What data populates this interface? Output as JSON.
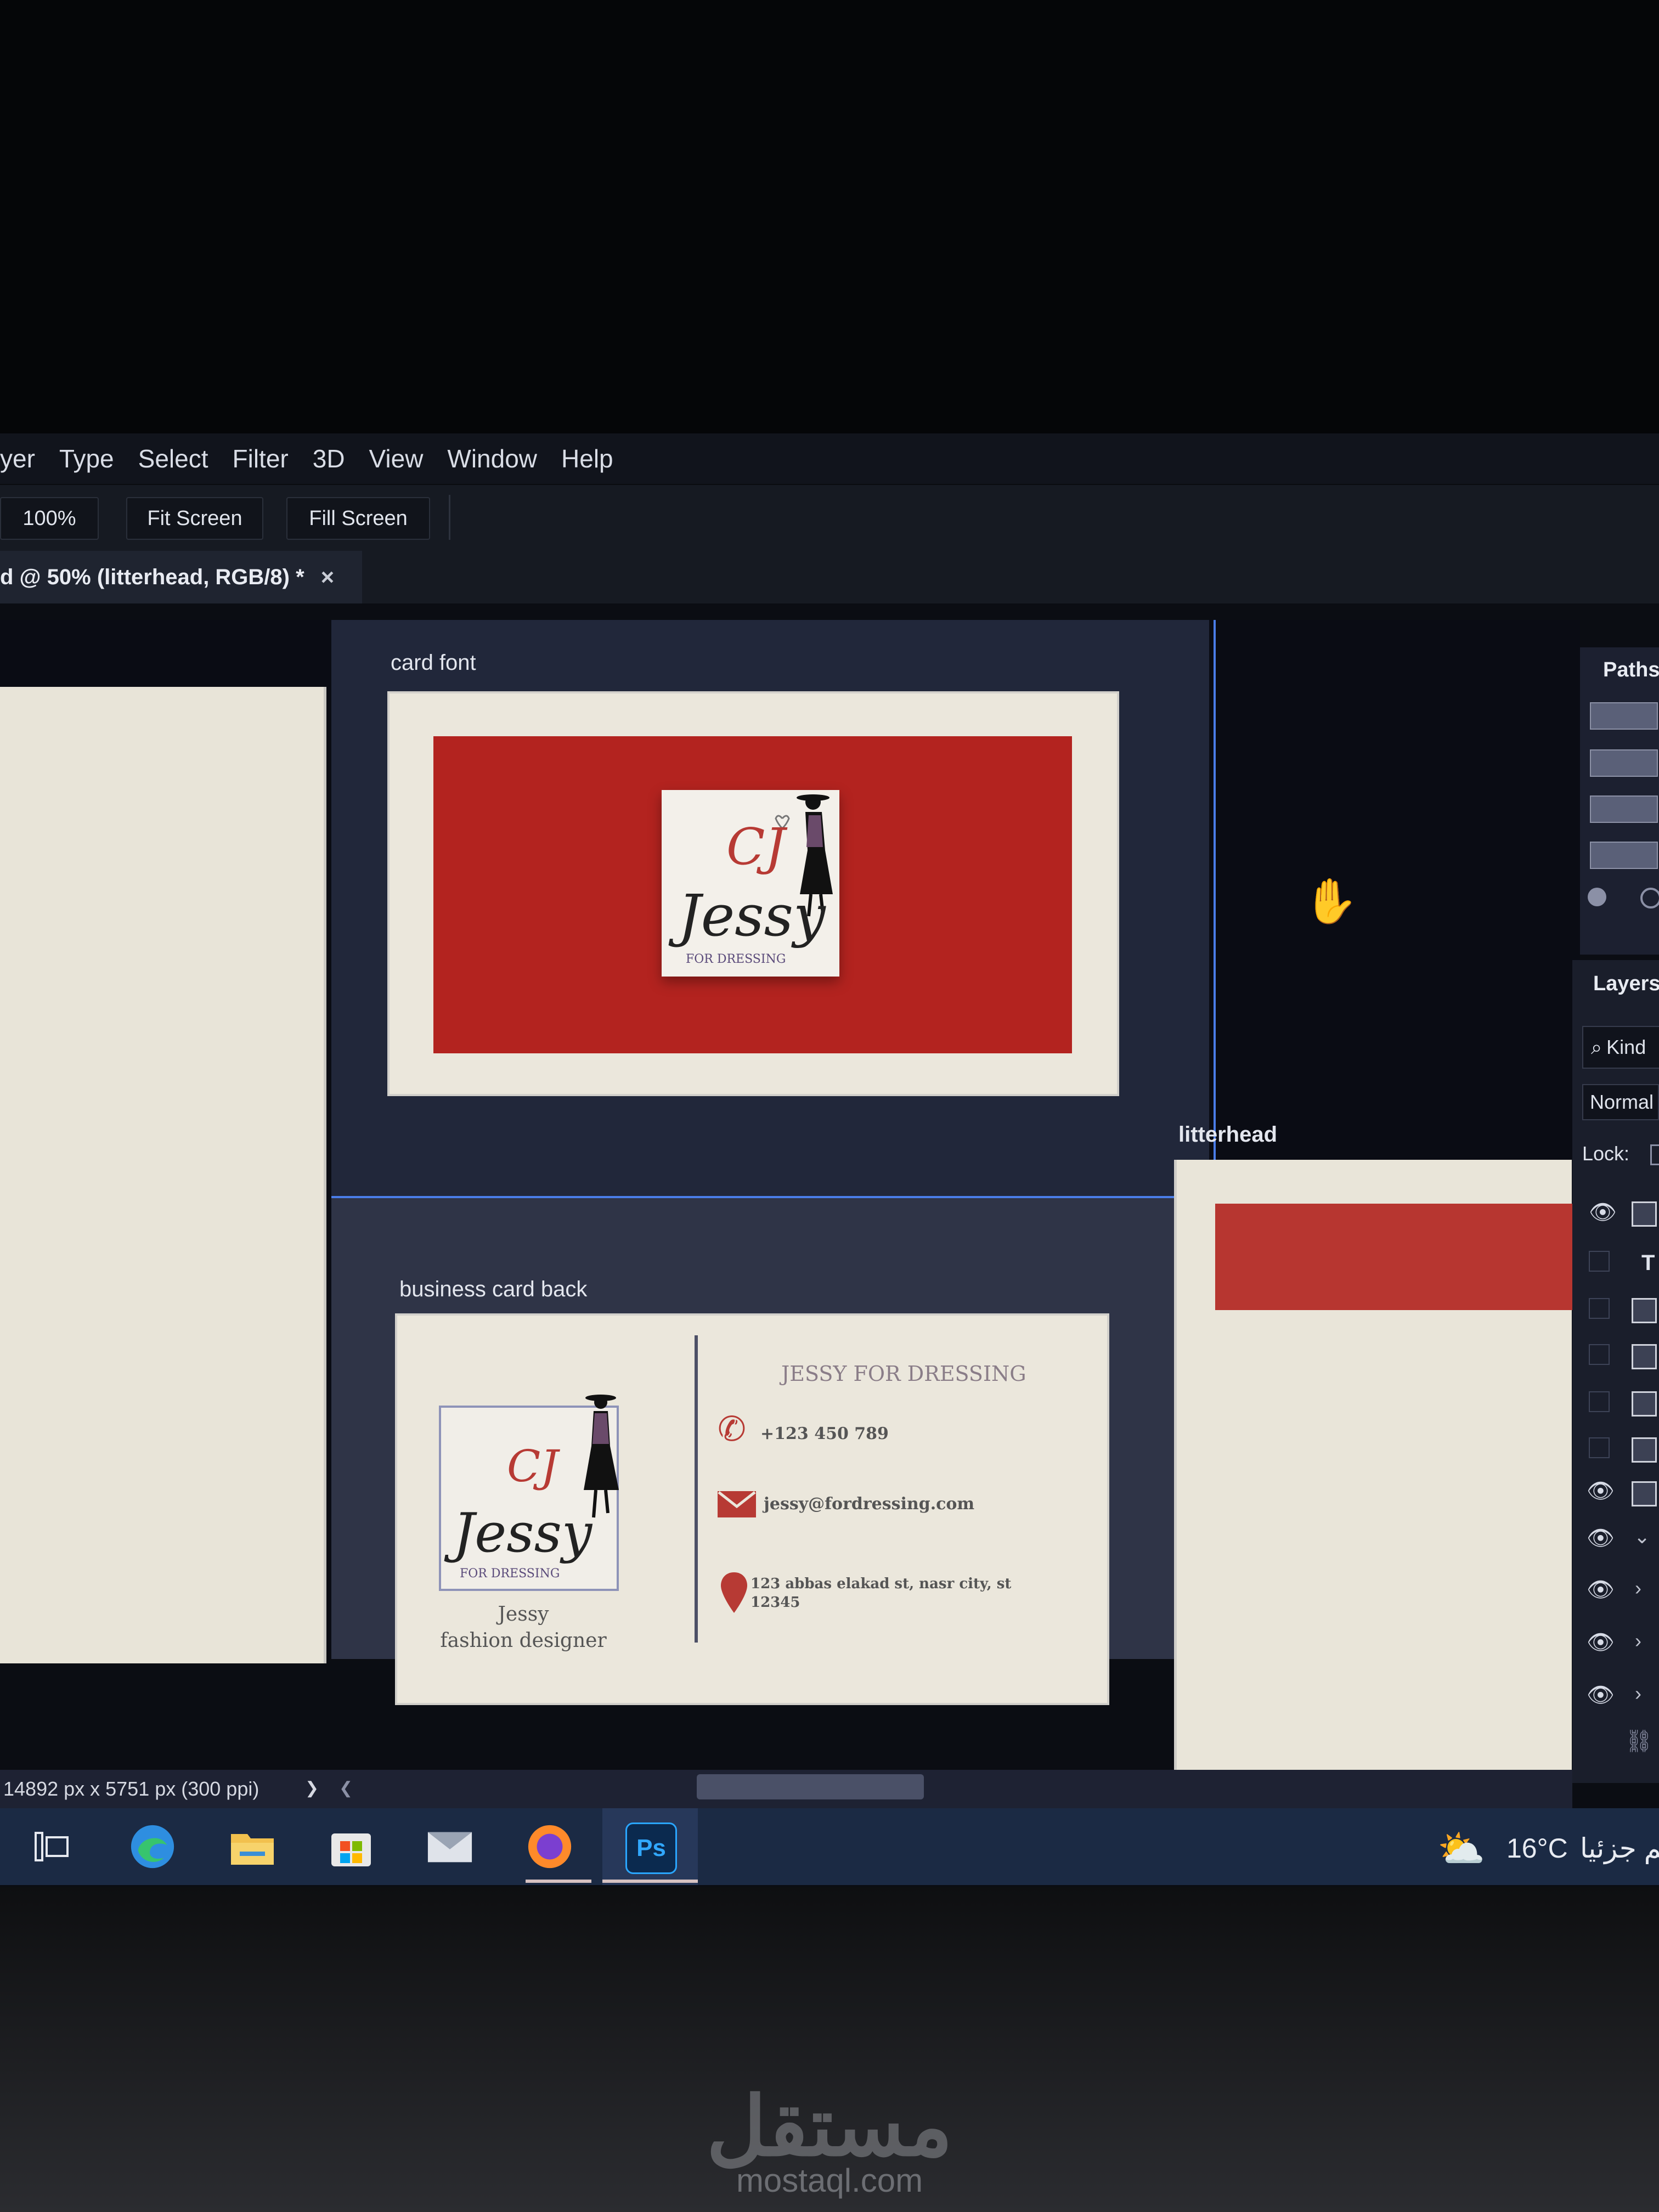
{
  "menu": [
    "yer",
    "Type",
    "Select",
    "Filter",
    "3D",
    "View",
    "Window",
    "Help"
  ],
  "options_bar": {
    "zoom": "100%",
    "fit_screen": "Fit Screen",
    "fill_screen": "Fill Screen"
  },
  "document_tab": {
    "title": "d @ 50% (litterhead, RGB/8) *",
    "close": "×"
  },
  "artboards": {
    "card_front_label": "card font",
    "card_back_label": "business card back",
    "letterhead_label": "litterhead"
  },
  "card_front": {
    "logo_initials": "CJ",
    "logo_name": "Jessy",
    "logo_sub": "FOR DRESSING"
  },
  "card_back": {
    "logo_initials": "CJ",
    "logo_name": "Jessy",
    "logo_sub": "FOR DRESSING",
    "name": "Jessy",
    "role": "fashion designer",
    "company": "JESSY FOR DRESSING",
    "phone": "+123 450 789",
    "email": "jessy@fordressing.com",
    "address_line1": "123 abbas elakad st, nasr city, st",
    "address_line2": "12345"
  },
  "panels": {
    "paths_title": "Paths",
    "layers_title": "Layers",
    "kind": "Kind",
    "blend_mode": "Normal",
    "lock_label": "Lock:"
  },
  "status_bar": {
    "doc_size": "14892 px x 5751 px (300 ppi)",
    "arrow_right": "❯",
    "arrow_left": "❮"
  },
  "taskbar": {
    "ps_label": "Ps",
    "temperature": "16°C",
    "weather_text": "غائم جزئيا"
  },
  "watermark": {
    "brand_ar": "مستقل",
    "brand_en": "mostaql.com"
  },
  "colors": {
    "card_red": "#b3231f",
    "guide_blue": "#4a7de8",
    "paper": "#ebe7dc"
  }
}
